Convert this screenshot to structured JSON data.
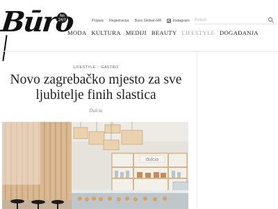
{
  "header": {
    "logo_text": "Būro",
    "logo_badge": "No 24/7",
    "links": [
      "Prijava",
      "Registracija",
      "Buro Global-HR",
      "Instagram"
    ],
    "search_placeholder": "Pretraži",
    "nav": [
      "MODA",
      "KULTURA",
      "MEDIJI",
      "BEAUTY",
      "LIFESTYLE",
      "DOGAĐANJA"
    ],
    "active_nav": "LIFESTYLE"
  },
  "article": {
    "tags": [
      "LIFESTYLE",
      "GASTRO"
    ],
    "tag_separator": "/",
    "title": "Novo zagrebačko mjesto za sve ljubitelje finih slastica",
    "author": "Dulcia",
    "photo": {
      "sign_text": "dulcia",
      "description_icon": "pastry-shop-interior-photo"
    }
  },
  "colors": {
    "text": "#222222",
    "muted": "#888888",
    "active_nav": "#a8a8a8",
    "divider": "#e6e6e6"
  }
}
